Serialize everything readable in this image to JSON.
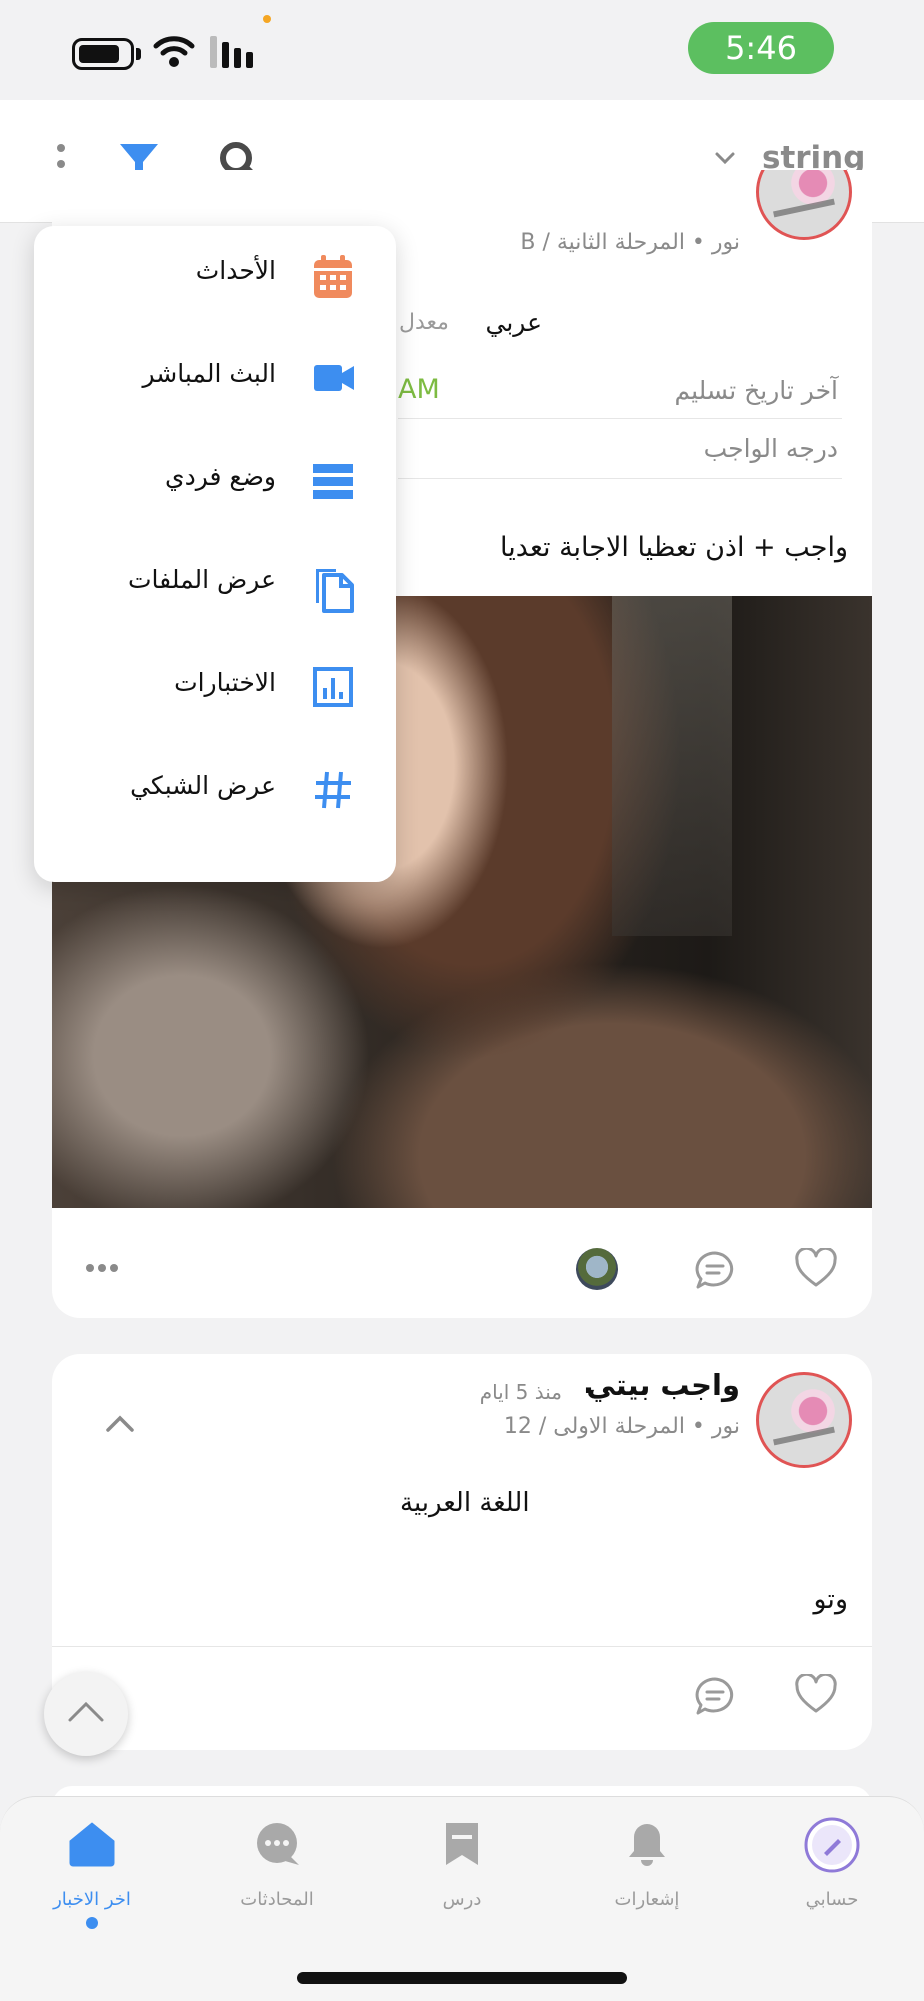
{
  "status_bar": {
    "time": "5:46"
  },
  "app_bar": {
    "title": "string"
  },
  "post1": {
    "meta": "نور  •  المرحلة الثانية / B",
    "subject": "عربي",
    "subject_extra": "معدل",
    "deadline_label": "آخر تاريخ تسليم",
    "deadline_value": "AM",
    "grade_label": "درجه الواجب",
    "body": "واجب + اذن تعظيا الاجابة تعديا"
  },
  "post2": {
    "title": "واجب بيتي",
    "separator": ".",
    "time": "منذ 5 ايام",
    "meta": "نور  •  المرحلة الاولى / 12",
    "subject": "اللغة العربية",
    "body": "وتو"
  },
  "menu": {
    "items": [
      {
        "label": "الأحداث",
        "icon": "calendar-icon",
        "color": "#f08a5d"
      },
      {
        "label": "البث المباشر",
        "icon": "video-camera-icon",
        "color": "#3d8ef0"
      },
      {
        "label": "وضع فردي",
        "icon": "list-view-icon",
        "color": "#3d8ef0"
      },
      {
        "label": "عرض الملفات",
        "icon": "files-icon",
        "color": "#3d8ef0"
      },
      {
        "label": "الاختبارات",
        "icon": "chart-icon",
        "color": "#3d8ef0"
      },
      {
        "label": "عرض الشبكي",
        "icon": "grid-hash-icon",
        "color": "#3d8ef0"
      }
    ]
  },
  "bottom_nav": {
    "items": [
      {
        "label": "اخر الاخبار",
        "icon": "home-icon",
        "active": true
      },
      {
        "label": "المحادثات",
        "icon": "chat-icon",
        "active": false
      },
      {
        "label": "درس",
        "icon": "bookmark-icon",
        "active": false
      },
      {
        "label": "إشعارات",
        "icon": "bell-icon",
        "active": false
      },
      {
        "label": "حسابي",
        "icon": "profile-icon",
        "active": false
      }
    ]
  },
  "colors": {
    "accent": "#3d8ef0",
    "time_pill": "#5cbf60",
    "deadline_green": "#7dbb42",
    "calendar_orange": "#f08a5d"
  }
}
